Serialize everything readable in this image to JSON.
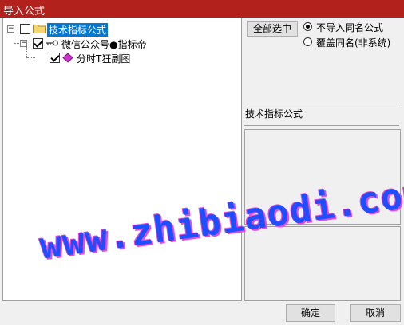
{
  "window": {
    "title": "导入公式"
  },
  "tree": {
    "root": {
      "label": "技术指标公式",
      "checked": false,
      "selected": true
    },
    "child": {
      "label": "微信公众号●指标帝",
      "checked": true
    },
    "leaf": {
      "label": "分时T狂副图",
      "checked": true
    }
  },
  "actions": {
    "select_all_label": "全部选中",
    "radio_skip_label": "不导入同名公式",
    "radio_overwrite_label": "覆盖同名(非系统)",
    "radio_selected": "skip"
  },
  "info": {
    "category_label": "技术指标公式"
  },
  "footer": {
    "ok_label": "确定",
    "cancel_label": "取消"
  },
  "watermark": {
    "text": "www.zhibiaodi.com"
  },
  "colors": {
    "titlebar": "#b3211c",
    "selection": "#0078d7",
    "watermark": "#1e4fff",
    "watermark_shadow": "#e64ad9"
  }
}
